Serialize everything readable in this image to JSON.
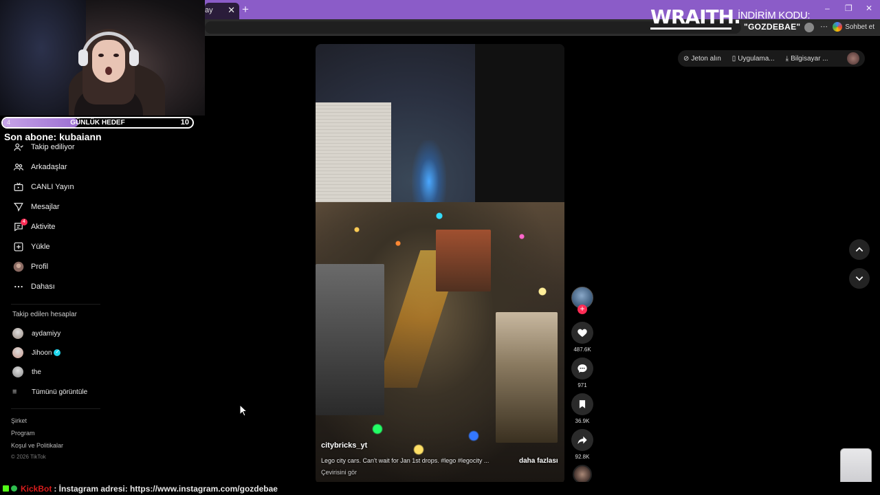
{
  "browser": {
    "tab_label": "ay",
    "sohbet_label": "Sohbet et"
  },
  "overlay": {
    "brand": "WRAITH.",
    "promo_line1": "İNDİRİM KODU:",
    "promo_line2": "\"GOZDEBAE\""
  },
  "goal": {
    "title": "GÜNLÜK HEDEF",
    "current": "4",
    "target": "10",
    "progress_fraction": 0.4
  },
  "last_sub": "Son abone: kubaiann",
  "sidebar": {
    "nav": [
      {
        "label": "Takip ediliyor",
        "icon": "following-icon"
      },
      {
        "label": "Arkadaşlar",
        "icon": "friends-icon"
      },
      {
        "label": "CANLI Yayın",
        "icon": "live-icon"
      },
      {
        "label": "Mesajlar",
        "icon": "messages-icon"
      },
      {
        "label": "Aktivite",
        "icon": "activity-icon",
        "badge": "4"
      },
      {
        "label": "Yükle",
        "icon": "upload-icon"
      },
      {
        "label": "Profil",
        "icon": "profile-icon"
      },
      {
        "label": "Dahası",
        "icon": "more-icon"
      }
    ],
    "followed_title": "Takip edilen hesaplar",
    "accounts": [
      {
        "name": "aydamiyy",
        "verified": false
      },
      {
        "name": "Jihoon",
        "verified": true
      },
      {
        "name": "the",
        "verified": false
      }
    ],
    "see_all": "Tümünü görüntüle",
    "footer": [
      "Şirket",
      "Program",
      "Koşul ve Politikalar"
    ],
    "copyright": "© 2026 TikTok"
  },
  "topbar": {
    "coins": "Jeton alın",
    "app": "Uygulama...",
    "desktop": "Bilgisayar ..."
  },
  "video": {
    "author": "citybricks_yt",
    "caption": "Lego city cars. Can't wait for Jan 1st drops. #lego #legocity ...",
    "more": "daha fazlası",
    "translate": "Çevirisini gör",
    "progress_fraction": 0.1
  },
  "actions": {
    "likes": "487.6K",
    "comments": "971",
    "saves": "36.9K",
    "shares": "92.8K"
  },
  "ticker": {
    "user": "KickBot",
    "message": ": İnstagram adresi: https://www.instagram.com/gozdebae"
  },
  "colors": {
    "accent": "#fe2c55",
    "titlebar": "#8b5cc8",
    "goal_fill": "#b48ee0",
    "verified": "#20d5ec"
  }
}
